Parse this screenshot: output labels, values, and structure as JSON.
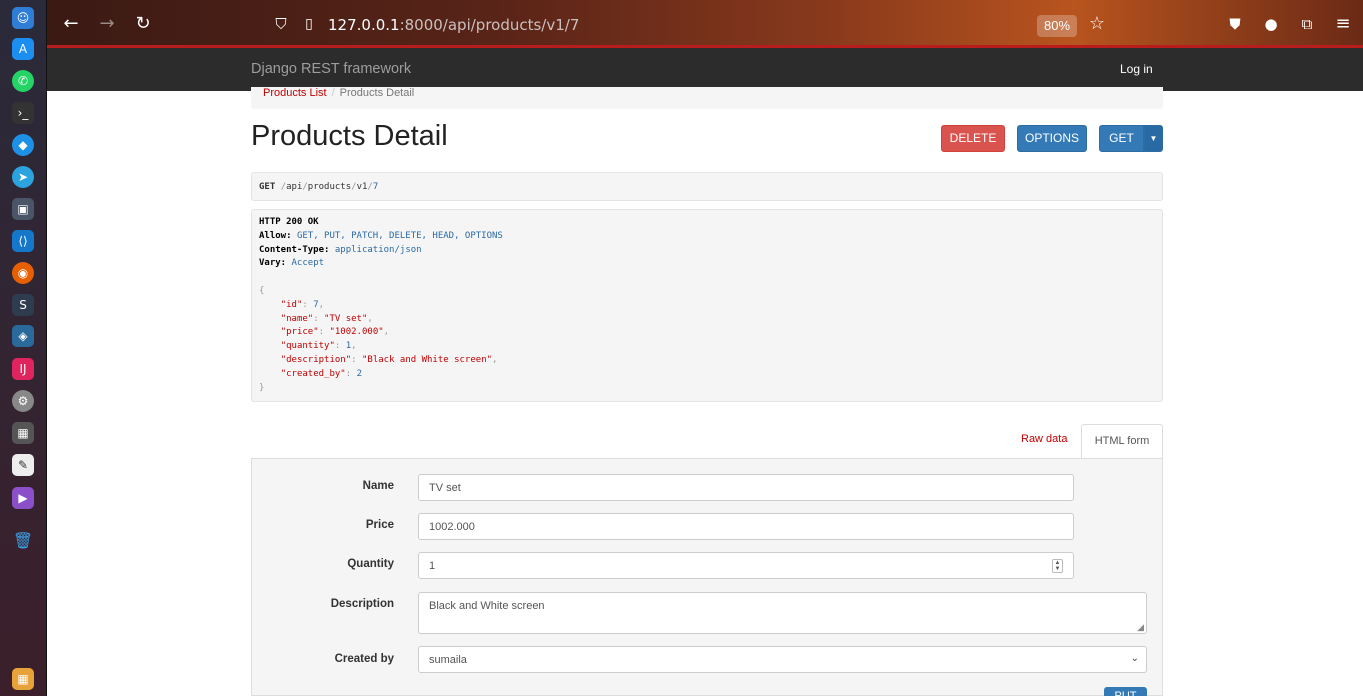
{
  "browser": {
    "url_host": "127.0.0.1",
    "url_path": ":8000/api/products/v1/7",
    "zoom": "80%"
  },
  "navbar": {
    "brand": "Django REST framework",
    "login": "Log in"
  },
  "breadcrumb": {
    "items": [
      "Products List",
      "Products Detail"
    ]
  },
  "page": {
    "title": "Products Detail",
    "buttons": {
      "delete": "DELETE",
      "options": "OPTIONS",
      "get": "GET"
    }
  },
  "request": {
    "method": "GET",
    "segments": [
      "api",
      "products",
      "v1",
      "7"
    ]
  },
  "response": {
    "status": "HTTP 200 OK",
    "headers": [
      {
        "name": "Allow:",
        "value": "GET, PUT, PATCH, DELETE, HEAD, OPTIONS"
      },
      {
        "name": "Content-Type:",
        "value": "application/json"
      },
      {
        "name": "Vary:",
        "value": "Accept"
      }
    ],
    "body": {
      "id": "7",
      "name": "\"TV set\"",
      "price": "\"1002.000\"",
      "quantity": "1",
      "description": "\"Black and White screen\"",
      "created_by": "2"
    }
  },
  "tabs": {
    "raw": "Raw data",
    "html": "HTML form"
  },
  "form": {
    "name_label": "Name",
    "name_value": "TV set",
    "price_label": "Price",
    "price_value": "1002.000",
    "quantity_label": "Quantity",
    "quantity_value": "1",
    "description_label": "Description",
    "description_value": "Black and White screen",
    "created_by_label": "Created by",
    "created_by_value": "sumaila",
    "put_label": "PUT"
  },
  "colors": {
    "primary": "#337ab7",
    "danger": "#d9534f",
    "link": "#c20000",
    "navbar": "#2c2c2c"
  }
}
